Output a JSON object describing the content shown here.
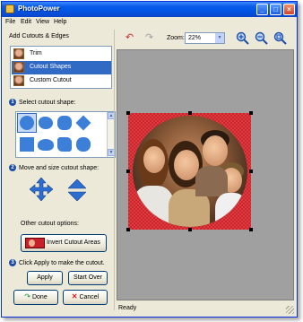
{
  "window": {
    "title": "PhotoPower"
  },
  "menu": [
    "File",
    "Edit",
    "View",
    "Help"
  ],
  "left_panel": {
    "heading": "Add Cutouts & Edges",
    "list": [
      {
        "label": "Trim",
        "selected": false
      },
      {
        "label": "Cutout Shapes",
        "selected": true
      },
      {
        "label": "Custom Cutout",
        "selected": false
      }
    ],
    "steps": [
      {
        "number": "1",
        "label": "Select cutout shape:"
      },
      {
        "number": "2",
        "label": "Move and size cutout shape:"
      },
      {
        "number": "3",
        "label": "Click Apply to make the cutout."
      }
    ],
    "other_options_label": "Other cutout options:",
    "invert_label": "Invert Cutout Areas",
    "apply_label": "Apply",
    "start_over_label": "Start Over",
    "done_label": "Done",
    "cancel_label": "Cancel"
  },
  "shapes": [
    "circle",
    "cloud",
    "scallop",
    "diamond",
    "square",
    "cloud-wide",
    "wavy-square",
    "flower",
    "rounded-square",
    "blob"
  ],
  "toolbar": {
    "undo_icon": "undo-arrow-icon",
    "redo_icon": "redo-arrow-icon",
    "zoom_label": "Zoom:",
    "zoom_value": "22%",
    "zoom_in_icon": "zoom-in-icon",
    "zoom_out_icon": "zoom-out-icon",
    "zoom_fit_icon": "zoom-fit-icon"
  },
  "status": {
    "text": "Ready"
  },
  "colors": {
    "accent": "#316ac5",
    "cutout_red": "#d2232a",
    "canvas_gray": "#a0a0a0",
    "title_blue": "#0055e5"
  }
}
